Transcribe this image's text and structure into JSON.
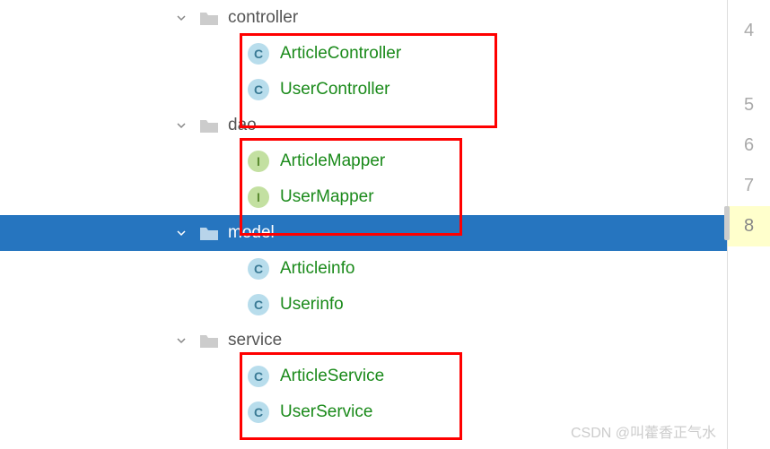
{
  "tree": {
    "folders": [
      {
        "name": "controller",
        "children": [
          {
            "icon": "C",
            "label": "ArticleController"
          },
          {
            "icon": "C",
            "label": "UserController"
          }
        ]
      },
      {
        "name": "dao",
        "children": [
          {
            "icon": "I",
            "label": "ArticleMapper"
          },
          {
            "icon": "I",
            "label": "UserMapper"
          }
        ]
      },
      {
        "name": "model",
        "selected": true,
        "children": [
          {
            "icon": "C",
            "label": "Articleinfo"
          },
          {
            "icon": "C",
            "label": "Userinfo"
          }
        ]
      },
      {
        "name": "service",
        "children": [
          {
            "icon": "C",
            "label": "ArticleService"
          },
          {
            "icon": "C",
            "label": "UserService"
          }
        ]
      }
    ]
  },
  "gutter": {
    "numbers": [
      "4",
      "5",
      "6",
      "7",
      "8"
    ],
    "active": "8"
  },
  "watermark": "CSDN @叫藿香正气水"
}
